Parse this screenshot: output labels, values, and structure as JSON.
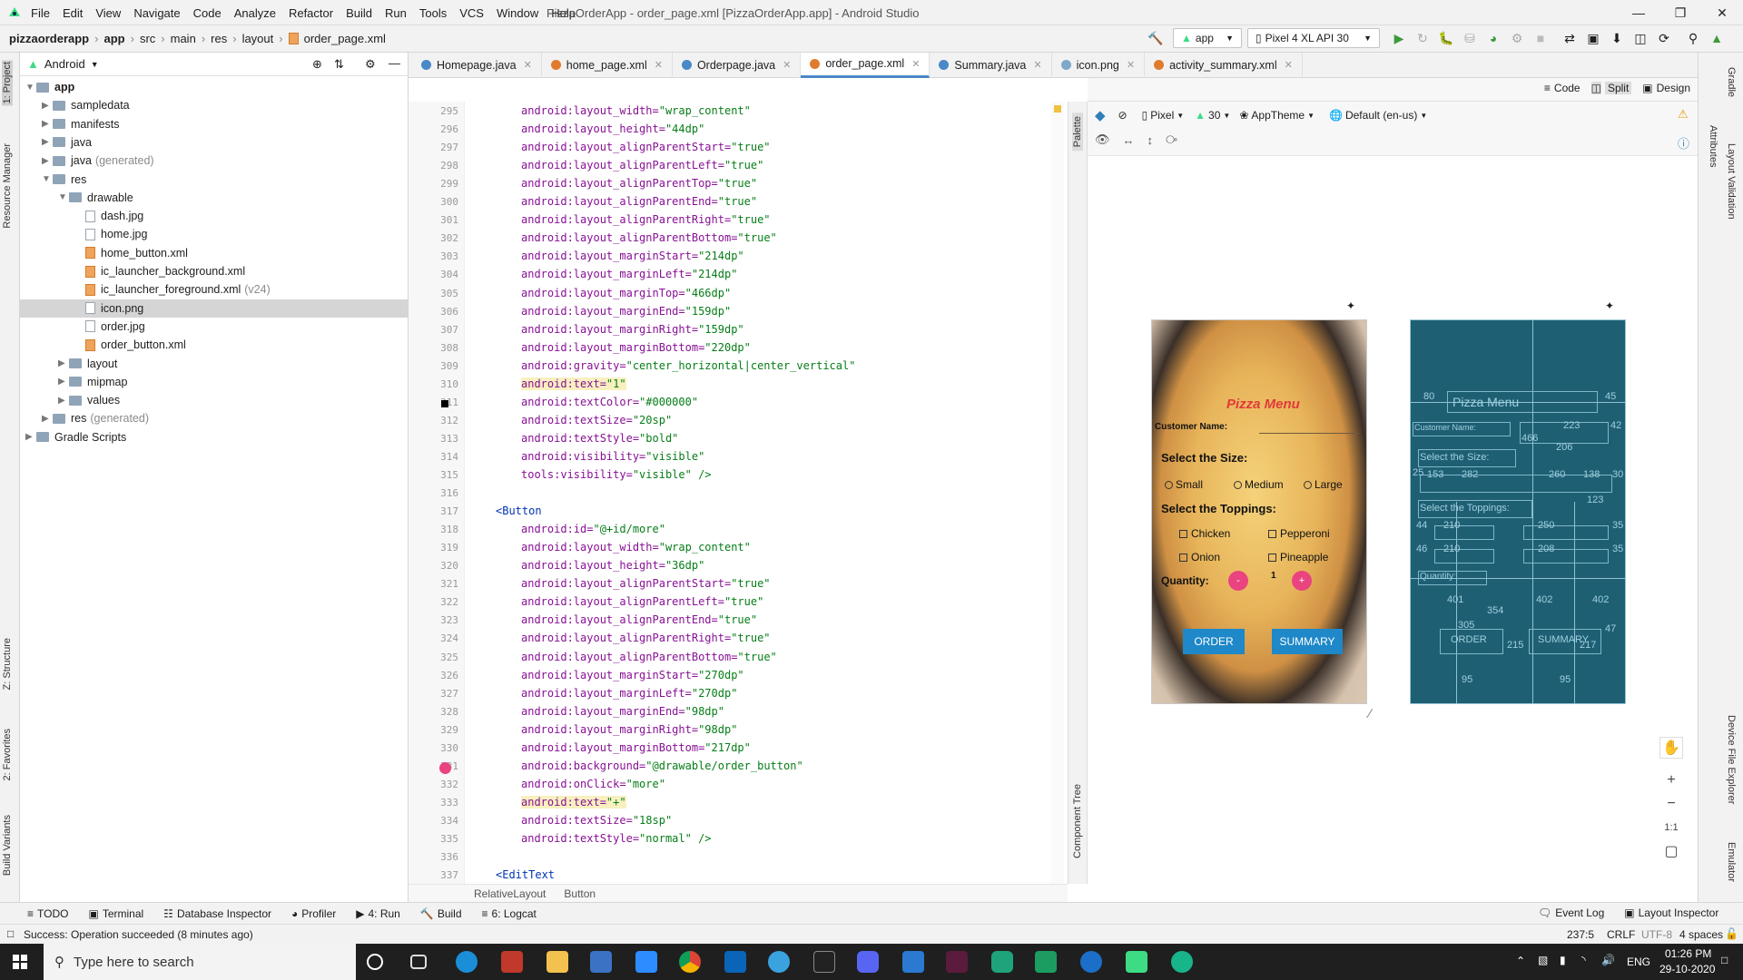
{
  "window": {
    "title": "PizzaOrderApp - order_page.xml [PizzaOrderApp.app] - Android Studio",
    "menu": [
      "File",
      "Edit",
      "View",
      "Navigate",
      "Code",
      "Analyze",
      "Refactor",
      "Build",
      "Run",
      "Tools",
      "VCS",
      "Window",
      "Help"
    ]
  },
  "breadcrumbs": [
    "pizzaorderapp",
    "app",
    "src",
    "main",
    "res",
    "layout",
    "order_page.xml"
  ],
  "toolbar": {
    "module": "app",
    "device": "Pixel 4 XL API 30"
  },
  "project_panel": {
    "view": "Android",
    "items": [
      {
        "label": "app",
        "indent": 0,
        "type": "folder",
        "expanded": true,
        "bold": true
      },
      {
        "label": "sampledata",
        "indent": 1,
        "type": "folder"
      },
      {
        "label": "manifests",
        "indent": 1,
        "type": "folder"
      },
      {
        "label": "java",
        "indent": 1,
        "type": "folder"
      },
      {
        "label": "java",
        "suffix": "(generated)",
        "indent": 1,
        "type": "folder"
      },
      {
        "label": "res",
        "indent": 1,
        "type": "folder",
        "expanded": true
      },
      {
        "label": "drawable",
        "indent": 2,
        "type": "folder",
        "expanded": true
      },
      {
        "label": "dash.jpg",
        "indent": 3,
        "type": "file"
      },
      {
        "label": "home.jpg",
        "indent": 3,
        "type": "file"
      },
      {
        "label": "home_button.xml",
        "indent": 3,
        "type": "xml"
      },
      {
        "label": "ic_launcher_background.xml",
        "indent": 3,
        "type": "xml"
      },
      {
        "label": "ic_launcher_foreground.xml",
        "suffix": "(v24)",
        "indent": 3,
        "type": "xml"
      },
      {
        "label": "icon.png",
        "indent": 3,
        "type": "file",
        "selected": true
      },
      {
        "label": "order.jpg",
        "indent": 3,
        "type": "file"
      },
      {
        "label": "order_button.xml",
        "indent": 3,
        "type": "xml"
      },
      {
        "label": "layout",
        "indent": 2,
        "type": "folder"
      },
      {
        "label": "mipmap",
        "indent": 2,
        "type": "folder"
      },
      {
        "label": "values",
        "indent": 2,
        "type": "folder"
      },
      {
        "label": "res",
        "suffix": "(generated)",
        "indent": 1,
        "type": "folder"
      },
      {
        "label": "Gradle Scripts",
        "indent": 0,
        "type": "folder"
      }
    ]
  },
  "tabs": [
    {
      "label": "Homepage.java",
      "color": "#4a88c7"
    },
    {
      "label": "home_page.xml",
      "color": "#e07b2d"
    },
    {
      "label": "Orderpage.java",
      "color": "#4a88c7"
    },
    {
      "label": "order_page.xml",
      "color": "#e07b2d",
      "active": true
    },
    {
      "label": "Summary.java",
      "color": "#4a88c7"
    },
    {
      "label": "icon.png",
      "color": "#7fa7c8"
    },
    {
      "label": "activity_summary.xml",
      "color": "#e07b2d"
    }
  ],
  "view_modes": [
    "Code",
    "Split",
    "Design"
  ],
  "code_lines": [
    {
      "n": "295",
      "indent": 2,
      "attr": "android:layout_width=",
      "val": "\"wrap_content\""
    },
    {
      "n": "296",
      "indent": 2,
      "attr": "android:layout_height=",
      "val": "\"44dp\""
    },
    {
      "n": "297",
      "indent": 2,
      "attr": "android:layout_alignParentStart=",
      "val": "\"true\""
    },
    {
      "n": "298",
      "indent": 2,
      "attr": "android:layout_alignParentLeft=",
      "val": "\"true\""
    },
    {
      "n": "299",
      "indent": 2,
      "attr": "android:layout_alignParentTop=",
      "val": "\"true\""
    },
    {
      "n": "300",
      "indent": 2,
      "attr": "android:layout_alignParentEnd=",
      "val": "\"true\""
    },
    {
      "n": "301",
      "indent": 2,
      "attr": "android:layout_alignParentRight=",
      "val": "\"true\""
    },
    {
      "n": "302",
      "indent": 2,
      "attr": "android:layout_alignParentBottom=",
      "val": "\"true\""
    },
    {
      "n": "303",
      "indent": 2,
      "attr": "android:layout_marginStart=",
      "val": "\"214dp\""
    },
    {
      "n": "304",
      "indent": 2,
      "attr": "android:layout_marginLeft=",
      "val": "\"214dp\""
    },
    {
      "n": "305",
      "indent": 2,
      "attr": "android:layout_marginTop=",
      "val": "\"466dp\""
    },
    {
      "n": "306",
      "indent": 2,
      "attr": "android:layout_marginEnd=",
      "val": "\"159dp\""
    },
    {
      "n": "307",
      "indent": 2,
      "attr": "android:layout_marginRight=",
      "val": "\"159dp\""
    },
    {
      "n": "308",
      "indent": 2,
      "attr": "android:layout_marginBottom=",
      "val": "\"220dp\""
    },
    {
      "n": "309",
      "indent": 2,
      "attr": "android:gravity=",
      "val": "\"center_horizontal|center_vertical\""
    },
    {
      "n": "310",
      "indent": 2,
      "attr": "android:text=",
      "val": "\"1\"",
      "hl": true
    },
    {
      "n": "311",
      "indent": 2,
      "attr": "android:textColor=",
      "val": "\"#000000\""
    },
    {
      "n": "312",
      "indent": 2,
      "attr": "android:textSize=",
      "val": "\"20sp\""
    },
    {
      "n": "313",
      "indent": 2,
      "attr": "android:textStyle=",
      "val": "\"bold\""
    },
    {
      "n": "314",
      "indent": 2,
      "attr": "android:visibility=",
      "val": "\"visible\""
    },
    {
      "n": "315",
      "indent": 2,
      "attr": "tools:visibility=",
      "val": "\"visible\" />"
    },
    {
      "n": "316",
      "indent": 0,
      "attr": "",
      "val": ""
    },
    {
      "n": "317",
      "indent": 1,
      "tag": "<Button"
    },
    {
      "n": "318",
      "indent": 2,
      "attr": "android:id=",
      "val": "\"@+id/more\""
    },
    {
      "n": "319",
      "indent": 2,
      "attr": "android:layout_width=",
      "val": "\"wrap_content\""
    },
    {
      "n": "320",
      "indent": 2,
      "attr": "android:layout_height=",
      "val": "\"36dp\""
    },
    {
      "n": "321",
      "indent": 2,
      "attr": "android:layout_alignParentStart=",
      "val": "\"true\""
    },
    {
      "n": "322",
      "indent": 2,
      "attr": "android:layout_alignParentLeft=",
      "val": "\"true\""
    },
    {
      "n": "323",
      "indent": 2,
      "attr": "android:layout_alignParentEnd=",
      "val": "\"true\""
    },
    {
      "n": "324",
      "indent": 2,
      "attr": "android:layout_alignParentRight=",
      "val": "\"true\""
    },
    {
      "n": "325",
      "indent": 2,
      "attr": "android:layout_alignParentBottom=",
      "val": "\"true\""
    },
    {
      "n": "326",
      "indent": 2,
      "attr": "android:layout_marginStart=",
      "val": "\"270dp\""
    },
    {
      "n": "327",
      "indent": 2,
      "attr": "android:layout_marginLeft=",
      "val": "\"270dp\""
    },
    {
      "n": "328",
      "indent": 2,
      "attr": "android:layout_marginEnd=",
      "val": "\"98dp\""
    },
    {
      "n": "329",
      "indent": 2,
      "attr": "android:layout_marginRight=",
      "val": "\"98dp\""
    },
    {
      "n": "330",
      "indent": 2,
      "attr": "android:layout_marginBottom=",
      "val": "\"217dp\""
    },
    {
      "n": "331",
      "indent": 2,
      "attr": "android:background=",
      "val": "\"@drawable/order_button\""
    },
    {
      "n": "332",
      "indent": 2,
      "attr": "android:onClick=",
      "val": "\"more\""
    },
    {
      "n": "333",
      "indent": 2,
      "attr": "android:text=",
      "val": "\"+\"",
      "hl": true
    },
    {
      "n": "334",
      "indent": 2,
      "attr": "android:textSize=",
      "val": "\"18sp\""
    },
    {
      "n": "335",
      "indent": 2,
      "attr": "android:textStyle=",
      "val": "\"normal\" />"
    },
    {
      "n": "336",
      "indent": 0,
      "attr": "",
      "val": ""
    },
    {
      "n": "337",
      "indent": 1,
      "tag": "<EditText"
    }
  ],
  "editor_breadcrumb": [
    "RelativeLayout",
    "Button"
  ],
  "design_toolbar": {
    "device": "Pixel",
    "api": "30",
    "theme": "AppTheme",
    "locale": "Default (en-us)"
  },
  "side_tabs": {
    "palette": "Palette",
    "component_tree": "Component Tree"
  },
  "phone": {
    "title": "Pizza Menu",
    "customer_label": "Customer Name:",
    "size_label": "Select the Size:",
    "sizes": [
      "Small",
      "Medium",
      "Large"
    ],
    "toppings_label": "Select the Toppings:",
    "toppings": [
      "Chicken",
      "Pepperoni",
      "Onion",
      "Pineapple"
    ],
    "quantity_label": "Quantity:",
    "minus": "-",
    "plus": "+",
    "quantity_value": "1",
    "order_button": "ORDER",
    "summary_button": "SUMMARY"
  },
  "blueprint": {
    "title": "Pizza Menu",
    "customer": "Customer Name:",
    "size": "Select the Size:",
    "toppings": "Select the Toppings:",
    "quantity": "Quantity:",
    "order": "ORDER",
    "summary": "SUMMARY",
    "dims": [
      "80",
      "45",
      "223",
      "42",
      "466",
      "206",
      "25",
      "153",
      "282",
      "260",
      "138",
      "30",
      "123",
      "44",
      "210",
      "250",
      "35",
      "46",
      "210",
      "208",
      "35",
      "401",
      "402",
      "402",
      "354",
      "305",
      "47",
      "215",
      "217",
      "95",
      "95"
    ]
  },
  "zoom_controls": [
    "+",
    "−",
    "1:1"
  ],
  "right_tabs": [
    "Gradle",
    "Attributes",
    "Layout Validation",
    "Device File Explorer",
    "Emulator"
  ],
  "left_tabs": [
    "1: Project",
    "Resource Manager",
    "Z: Structure",
    "2: Favorites",
    "Build Variants"
  ],
  "bottom_tools": [
    "TODO",
    "Terminal",
    "Database Inspector",
    "Profiler",
    "4: Run",
    "Build",
    "6: Logcat"
  ],
  "bottom_right_tools": [
    "Event Log",
    "Layout Inspector"
  ],
  "status": {
    "message": "Success: Operation succeeded (8 minutes ago)",
    "position": "237:5",
    "line_sep": "CRLF",
    "encoding": "UTF-8",
    "indent": "4 spaces"
  },
  "taskbar": {
    "search_placeholder": "Type here to search",
    "time": "01:26 PM",
    "date": "29-10-2020",
    "lang": "ENG"
  }
}
